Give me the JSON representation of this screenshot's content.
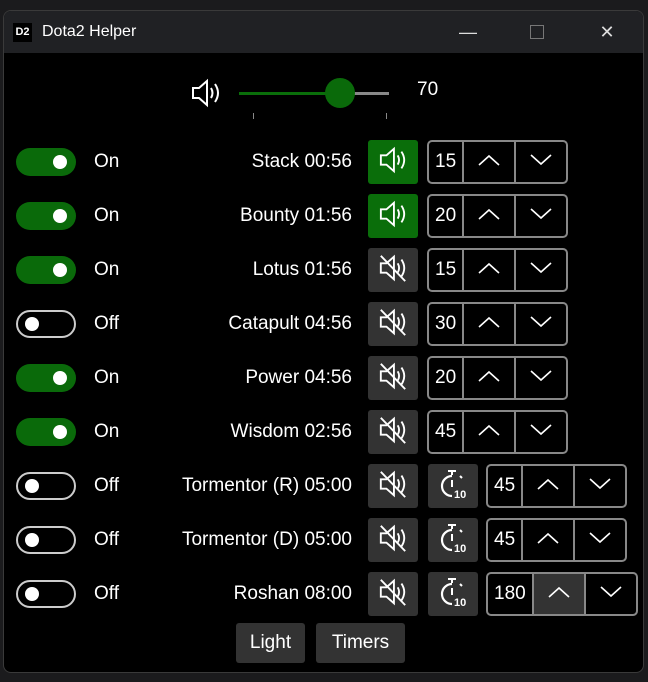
{
  "window": {
    "logo": "D2",
    "title": "Dota2 Helper"
  },
  "volume": {
    "value": "70",
    "level": 70
  },
  "rows": [
    {
      "enabled": true,
      "state": "On",
      "name": "Stack 00:56",
      "sound": true,
      "value": "15",
      "timer": false
    },
    {
      "enabled": true,
      "state": "On",
      "name": "Bounty 01:56",
      "sound": true,
      "value": "20",
      "timer": false
    },
    {
      "enabled": true,
      "state": "On",
      "name": "Lotus 01:56",
      "sound": false,
      "value": "15",
      "timer": false
    },
    {
      "enabled": false,
      "state": "Off",
      "name": "Catapult 04:56",
      "sound": false,
      "value": "30",
      "timer": false
    },
    {
      "enabled": true,
      "state": "On",
      "name": "Power 04:56",
      "sound": false,
      "value": "20",
      "timer": false
    },
    {
      "enabled": true,
      "state": "On",
      "name": "Wisdom 02:56",
      "sound": false,
      "value": "45",
      "timer": false
    },
    {
      "enabled": false,
      "state": "Off",
      "name": "Tormentor (R) 05:00",
      "sound": false,
      "value": "45",
      "timer": true
    },
    {
      "enabled": false,
      "state": "Off",
      "name": "Tormentor (D) 05:00",
      "sound": false,
      "value": "45",
      "timer": true
    },
    {
      "enabled": false,
      "state": "Off",
      "name": "Roshan 08:00",
      "sound": false,
      "value": "180",
      "timer": true
    }
  ],
  "timer_icon_label": "10",
  "buttons": {
    "light": "Light",
    "timers": "Timers"
  },
  "colors": {
    "accent": "#0a6e0a",
    "button": "#333333"
  }
}
